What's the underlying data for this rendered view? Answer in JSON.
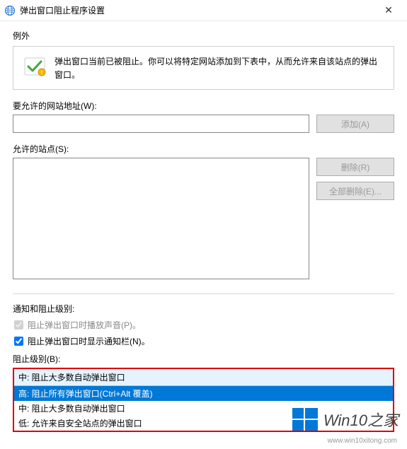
{
  "window": {
    "title": "弹出窗口阻止程序设置",
    "close_glyph": "✕"
  },
  "exceptions": {
    "heading": "例外",
    "info": "弹出窗口当前已被阻止。你可以将特定网站添加到下表中，从而允许来自该站点的弹出窗口。",
    "address_label": "要允许的网站地址(W):",
    "address_value": "",
    "add_button": "添加(A)",
    "allowed_label": "允许的站点(S):",
    "remove_button": "删除(R)",
    "remove_all_button": "全部删除(E)..."
  },
  "notifications": {
    "heading": "通知和阻止级别:",
    "sound_label": "阻止弹出窗口时播放声音(P)。",
    "sound_checked": true,
    "sound_disabled": true,
    "infobar_label": "阻止弹出窗口时显示通知栏(N)。",
    "infobar_checked": true,
    "level_label": "阻止级别(B):",
    "dropdown": {
      "selected": "中: 阻止大多数自动弹出窗口",
      "options": [
        "高: 阻止所有弹出窗口(Ctrl+Alt 覆盖)",
        "中: 阻止大多数自动弹出窗口",
        "低: 允许来自安全站点的弹出窗口"
      ],
      "highlighted_index": 0
    }
  },
  "watermark": {
    "text": "Win10之家",
    "url": "www.win10xitong.com"
  }
}
